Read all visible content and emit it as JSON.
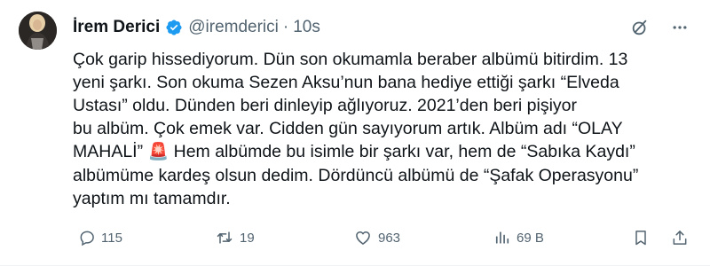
{
  "tweet": {
    "author_name": "İrem Derici",
    "handle": "@iremderici",
    "separator": "·",
    "time": "10s",
    "body_lines": [
      "Çok garip hissediyorum. Dün son okumamla beraber albümü bitirdim. 13",
      "yeni şarkı. Son okuma Sezen Aksu’nun bana hediye ettiği şarkı “Elveda",
      "Ustası” oldu. Dünden beri dinleyip ağlıyoruz. 2021’den beri pişiyor",
      "bu albüm. Çok emek var. Cidden gün sayıyorum artık. Albüm adı “OLAY",
      "MAHALİ”",
      "Hem albümde bu isimle bir şarkı var, hem de “Sabıka Kaydı”",
      "albümüme kardeş olsun dedim. Dördüncü albümü de “Şafak Operasyonu”",
      "yaptım mı tamamdır."
    ],
    "emoji": "🚨",
    "stats": {
      "replies": "115",
      "retweets": "19",
      "likes": "963",
      "views": "69 B"
    }
  },
  "icons": {
    "verified": "verified-badge-icon",
    "grok": "grok-icon",
    "more": "more-icon",
    "reply": "reply-icon",
    "retweet": "retweet-icon",
    "like": "like-icon",
    "views": "views-icon",
    "bookmark": "bookmark-icon",
    "share": "share-icon"
  },
  "colors": {
    "text": "#0f1419",
    "secondary": "#536471",
    "verified": "#1d9bf0",
    "siren": "#e0243b"
  }
}
